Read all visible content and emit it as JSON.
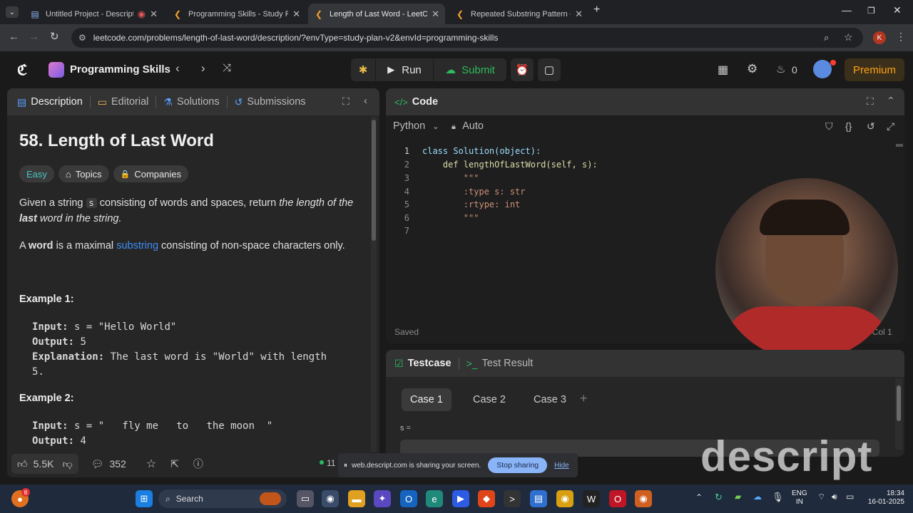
{
  "browser": {
    "tabs": [
      {
        "label": "Untitled Project - Descript",
        "active": false
      },
      {
        "label": "Programming Skills - Study Plan",
        "active": false
      },
      {
        "label": "Length of Last Word - LeetCode",
        "active": true
      },
      {
        "label": "Repeated Substring Pattern - Le",
        "active": false
      }
    ],
    "url": "leetcode.com/problems/length-of-last-word/description/?envType=study-plan-v2&envId=programming-skills",
    "profile_initial": "K"
  },
  "header": {
    "study_plan": "Programming Skills",
    "run_label": "Run",
    "submit_label": "Submit",
    "fire_count": "0",
    "premium_label": "Premium"
  },
  "left_panel": {
    "tabs": {
      "description": "Description",
      "editorial": "Editorial",
      "solutions": "Solutions",
      "submissions": "Submissions"
    },
    "title": "58. Length of Last Word",
    "difficulty": "Easy",
    "topics": "Topics",
    "companies": "Companies",
    "para1": {
      "a": "Given a string ",
      "code": "s",
      "b": " consisting of words and spaces, return ",
      "c": "the length of the",
      "d": "last",
      "e": " word in the string."
    },
    "para2": {
      "a": "A ",
      "b": "word",
      "c": " is a maximal ",
      "link": "substring",
      "d": " consisting of non-space characters only."
    },
    "example1": {
      "heading": "Example 1:",
      "input_label": "Input:",
      "input": " s = \"Hello World\"",
      "output_label": "Output:",
      "output": " 5",
      "explanation_label": "Explanation:",
      "explanation": " The last word is \"World\" with length",
      "explanation_cont": "5."
    },
    "example2": {
      "heading": "Example 2:",
      "input_label": "Input:",
      "input": " s = \"   fly me   to   the moon  \"",
      "output_label": "Output:",
      "output": " 4"
    },
    "footer": {
      "likes": "5.5K",
      "comments": "352",
      "online": "11"
    }
  },
  "code_panel": {
    "title": "Code",
    "language": "Python",
    "mode": "Auto",
    "lines": [
      {
        "n": "1",
        "text": "class Solution(object):"
      },
      {
        "n": "2",
        "text": "    def lengthOfLastWord(self, s):"
      },
      {
        "n": "3",
        "text": "        \"\"\""
      },
      {
        "n": "4",
        "text": "        :type s: str"
      },
      {
        "n": "5",
        "text": "        :rtype: int"
      },
      {
        "n": "6",
        "text": "        \"\"\""
      },
      {
        "n": "7",
        "text": ""
      }
    ],
    "saved": "Saved",
    "cursor": ", Col 1"
  },
  "test_panel": {
    "testcase_tab": "Testcase",
    "result_tab": "Test Result",
    "cases": [
      "Case 1",
      "Case 2",
      "Case 3"
    ],
    "add": "+",
    "var_label": "s ="
  },
  "share_bar": {
    "message": "web.descript.com is sharing your screen.",
    "stop": "Stop sharing",
    "hide": "Hide"
  },
  "watermark": "descript",
  "taskbar": {
    "search": "Search",
    "lang": "ENG",
    "region": "IN",
    "time": "18:34",
    "date": "16-01-2025",
    "badge": "8"
  }
}
